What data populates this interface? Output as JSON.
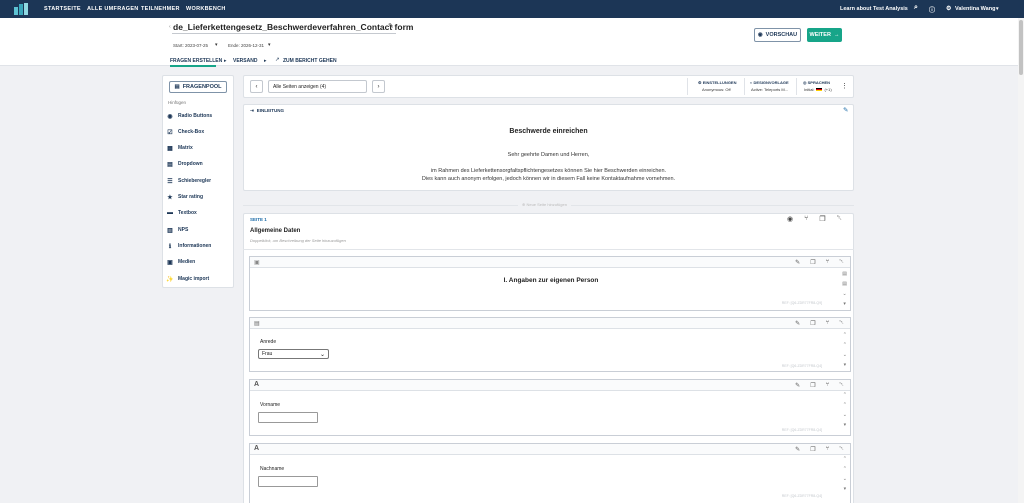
{
  "topbar": {
    "nav": [
      "STARTSEITE",
      "ALLE UMFRAGEN",
      "TEILNEHMER",
      "WORKBENCH"
    ],
    "learn": "Learn about Test Analysis",
    "user": "Valentina Wang"
  },
  "survey": {
    "title": "de_Lieferkettengesetz_Beschwerdeverfahren_Contact form",
    "start": "Start: 2023-07-25",
    "end": "Ende: 2026-12-31"
  },
  "tabs": [
    "FRAGEN ERSTELLEN",
    "VERSAND",
    "ZUM BERICHT GEHEN"
  ],
  "buttons": {
    "preview": "VORSCHAU",
    "next": "WEITER"
  },
  "sidebar": {
    "pool": "FRAGENPOOL",
    "section": "Hinfügen",
    "items": [
      "Radio Buttons",
      "Check-Box",
      "Matrix",
      "Dropdown",
      "Schieberegler",
      "Star rating",
      "Textbox",
      "NPS",
      "Informationen",
      "Medien",
      "Magic import"
    ]
  },
  "toolbar": {
    "pages": "Alle Seiten anzeigen (4)",
    "settings_label": "EINSTELLUNGEN",
    "settings_value": "Anonymous: Off",
    "design_label": "DESIGNVORLAGE",
    "design_value": "Active: Teleports M...",
    "lang_label": "SPRACHEN",
    "lang_value": "Initial:",
    "lang_more": "(+1)"
  },
  "intro": {
    "label": "EINLEITUNG",
    "title": "Beschwerde einreichen",
    "greeting": "Sehr geehrte Damen und Herren,",
    "line1": "im Rahmen des Lieferkettensorgfaltspflichtengesetzes können Sie hier Beschwerden einreichen.",
    "line2": "Dies kann auch anonym erfolgen, jedoch können wir in diesem Fall keine Kontaktaufnahme vornehmen."
  },
  "add_page": "Neue Seite hinzufügen",
  "page1": {
    "label": "SEITE 1",
    "title": "Allgemeine Daten",
    "hint": "Doppelklick, um Beschreibung der Seite hinzuzufügen"
  },
  "questions": [
    {
      "title": "I. Angaben zur eigenen Person",
      "ref": "REF: [Q6-ZDR77FR8-Q9]"
    },
    {
      "label": "Anrede",
      "value": "Frau",
      "ref": "REF: [Q6-ZDR77FR8-Q4]"
    },
    {
      "label": "Vorname",
      "ref": "REF: [Q6-ZDR77FR8-Q4]"
    },
    {
      "label": "Nachname",
      "ref": "REF: [Q6-ZDR77FR8-Q4]"
    }
  ]
}
